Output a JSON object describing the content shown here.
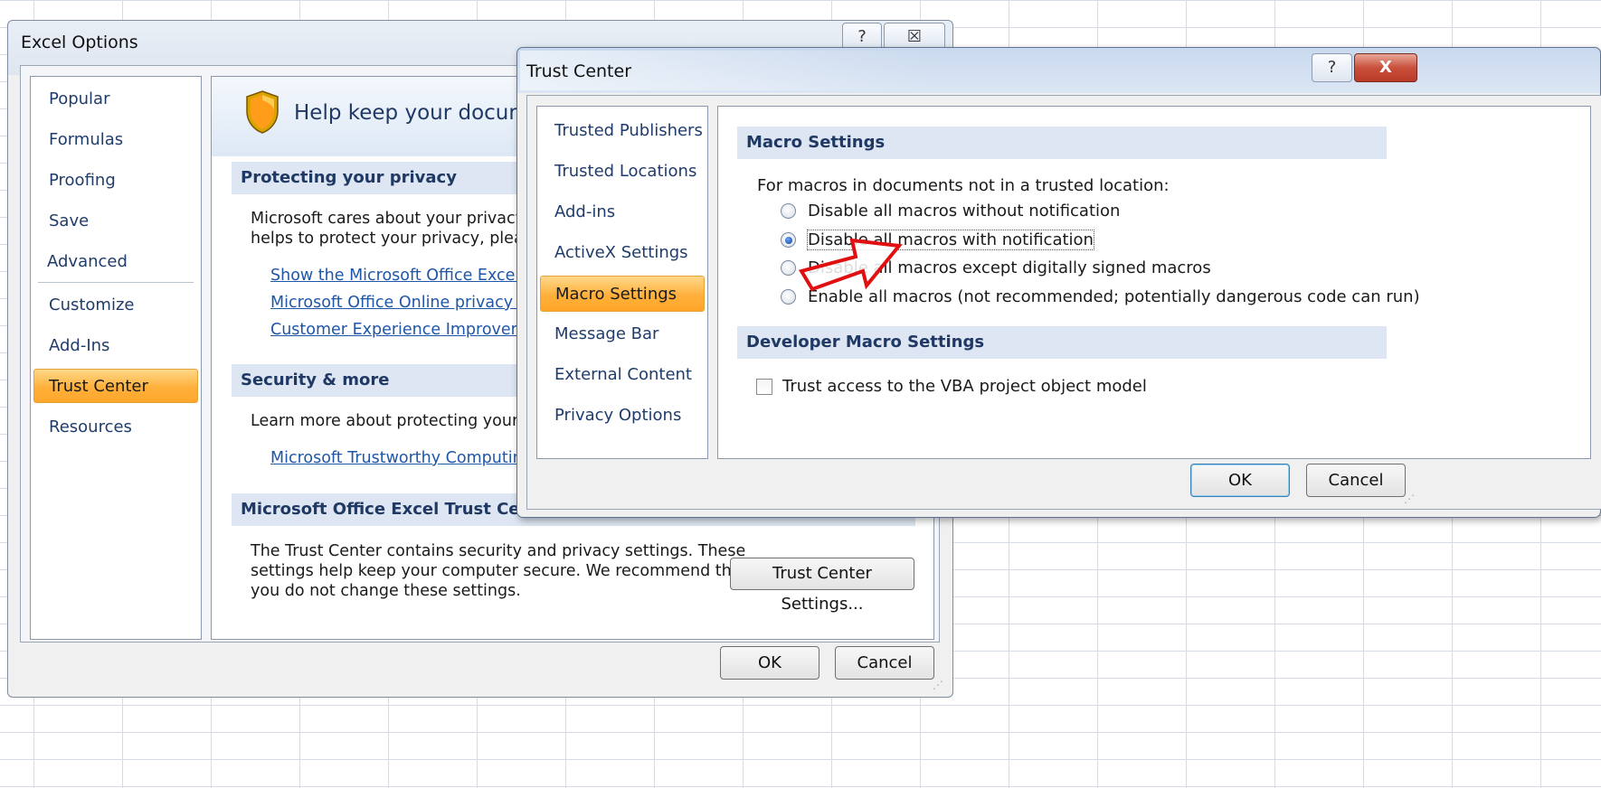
{
  "excel_options": {
    "title": "Excel Options",
    "help_glyph": "?",
    "close_glyph": "☒",
    "nav": [
      {
        "label": "Popular"
      },
      {
        "label": "Formulas"
      },
      {
        "label": "Proofing"
      },
      {
        "label": "Save"
      },
      {
        "label": "Advanced"
      },
      {
        "label": "Customize"
      },
      {
        "label": "Add-Ins"
      },
      {
        "label": "Trust Center"
      },
      {
        "label": "Resources"
      }
    ],
    "selected_nav": "Trust Center",
    "header_text": "Help keep your documents",
    "privacy": {
      "heading": "Protecting your privacy",
      "text_line1": "Microsoft cares about your privacy. Fo",
      "text_line2": "helps to protect your privacy, please s",
      "links": [
        "Show the Microsoft Office Excel pri",
        "Microsoft Office Online privacy stat",
        "Customer Experience Improvement"
      ]
    },
    "security": {
      "heading": "Security & more",
      "text": "Learn more about protecting your priv",
      "link": "Microsoft Trustworthy Computing"
    },
    "trust_center": {
      "heading": "Microsoft Office Excel Trust Center",
      "text_line1": "The Trust Center contains security and privacy settings. These",
      "text_line2": "settings help keep your computer secure. We recommend that",
      "text_line3": "you do not change these settings.",
      "settings_button": "Trust Center Settings..."
    },
    "ok": "OK",
    "cancel": "Cancel"
  },
  "trust_center_dialog": {
    "title": "Trust Center",
    "help_glyph": "?",
    "close_glyph": "X",
    "nav": [
      {
        "label": "Trusted Publishers"
      },
      {
        "label": "Trusted Locations"
      },
      {
        "label": "Add-ins"
      },
      {
        "label": "ActiveX Settings"
      },
      {
        "label": "Macro Settings"
      },
      {
        "label": "Message Bar"
      },
      {
        "label": "External Content"
      },
      {
        "label": "Privacy Options"
      }
    ],
    "selected_nav": "Macro Settings",
    "macro_heading": "Macro Settings",
    "macro_intro": "For macros in documents not in a trusted location:",
    "options": [
      {
        "label": "Disable all macros without notification",
        "selected": false
      },
      {
        "label": "Disable all macros with notification",
        "selected": true
      },
      {
        "label": "Disable all macros except digitally signed macros",
        "selected": false
      },
      {
        "label": "Enable all macros (not recommended; potentially dangerous code can run)",
        "selected": false
      }
    ],
    "developer_heading": "Developer Macro Settings",
    "vba_label": "Trust access to the VBA project object model",
    "vba_checked": false,
    "ok": "OK",
    "cancel": "Cancel"
  },
  "annotation": {
    "icon": "red-arrow-icon",
    "color": "#e01010"
  }
}
